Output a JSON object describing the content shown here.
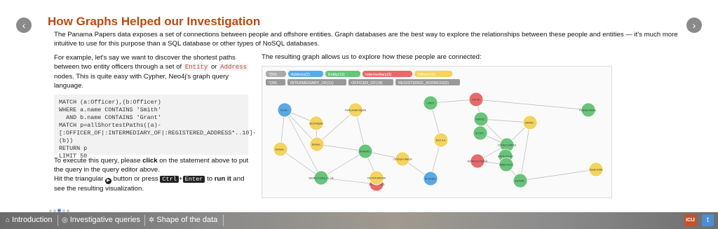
{
  "nav": {
    "prev_icon": "chevron-left-icon",
    "next_icon": "chevron-right-icon",
    "prev_glyph": "‹",
    "next_glyph": "›"
  },
  "title": "How Graphs Helped our Investigation",
  "intro": "The Panama Papers data exposes a set of connections between people and offshore entities. Graph databases are the best way to explore the relationships between these people and entities — it's much more intuitive to use for this purpose than a SQL database or other types of NoSQL databases.",
  "left": {
    "p1_a": "For example, let's say we want to discover the shortest paths between two entity officers through a set of ",
    "entity": "Entity",
    "or": " or ",
    "address": "Address",
    "p1_b": " nodes. This is quite easy with Cypher, Neo4j's graph query language."
  },
  "code": "MATCH (a:Officer),(b:Officer)\nWHERE a.name CONTAINS 'Smith'\n  AND b.name CONTAINS 'Grant'\nMATCH p=allShortestPaths((a)-[:OFFICER_OF|:INTERMEDIARY_OF|:REGISTERED_ADDRESS*..10]-(b))\nRETURN p\nLIMIT 50",
  "exec": {
    "a": "To execute this query, please ",
    "click": "click",
    "b": " on the statement above to put the query in the query editor above.",
    "c": "Hit the triangular ",
    "play": "▶",
    "d": " button or press ",
    "ctrl": "Ctrl",
    "plus": "+",
    "enter": "Enter",
    "e": " to ",
    "run": "run it",
    "f": " and see the resulting visualization."
  },
  "graph_caption": "The resulting graph allows us to explore how these people are connected:",
  "graph": {
    "labels_row1": [
      {
        "text": "*(50)",
        "color": "#aaaaaa"
      },
      {
        "text": "Address(2)",
        "color": "#5aa9e6"
      },
      {
        "text": "Entity(13)",
        "color": "#68c47a"
      },
      {
        "text": "Intermediary(3)",
        "color": "#e76a6a"
      },
      {
        "text": "Officer(10)",
        "color": "#f4d35e"
      }
    ],
    "labels_row2": [
      "*(34)",
      "INTERMEDIARY_OF(11)",
      "OFFICER_OF(18)",
      "REGISTERED_ADDRESS(5)"
    ],
    "node_colors": {
      "address": "#5aa9e6",
      "entity": "#68c47a",
      "intermediary": "#e76a6a",
      "officer": "#f4d35e"
    },
    "node_labels": [
      "Kenzie...",
      "Annika Moller Algaide",
      "Jacob Algaide",
      "Barbara...",
      "Barbara...",
      "MORGAN...",
      "Christophe Bianchi",
      "Batsfield Trading Co. Ltd",
      "JACOB COOLS",
      "TALITHA WIDDEN",
      "Bri Stratton",
      "LANDIT",
      "MCC S.A.",
      "CAT SH",
      "NORDIC...",
      "GLOTAT...",
      "DAVINE...",
      "Professor Manny...",
      "COFTEN LIMITED",
      "EMNY...",
      "BAY ROCK NO",
      "SWEET ALEX",
      "FERNOS & PEIRCE",
      "SAUNDR...",
      "Daniel Smith"
    ],
    "edge_label": "OFFICER_OF"
  },
  "carousel": {
    "count": 5,
    "active": 3
  },
  "footer": {
    "intro": "Introduction",
    "queries": "Investigative queries",
    "shape": "Shape of the data",
    "icu": "ICIJ",
    "twitter_glyph": "t"
  }
}
